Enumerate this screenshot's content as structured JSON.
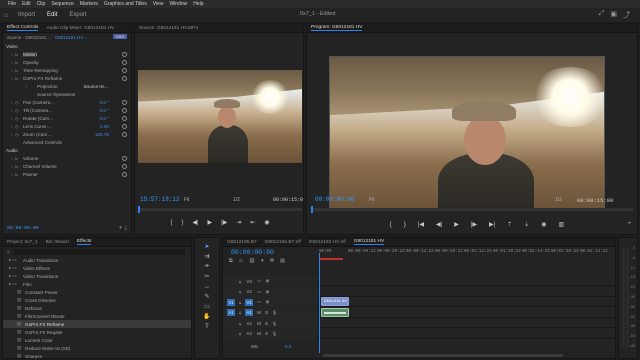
{
  "menubar": {
    "items": [
      "File",
      "Edit",
      "Clip",
      "Sequence",
      "Markers",
      "Graphics and Titles",
      "View",
      "Window",
      "Help"
    ]
  },
  "workspace": {
    "tabs": [
      "Import",
      "Edit",
      "Export"
    ],
    "active": "Edit",
    "title": "0x7_1 - Edited"
  },
  "effect_controls": {
    "tabs": [
      "Effect Controls",
      "Audio Clip Mixer: G8012181 HV",
      "Source: G8012181 HV.MP4"
    ],
    "source_label": "Source · G8012181…",
    "clip_label": "G8012181 HV…",
    "clip_chip": "G801",
    "video_header": "Video",
    "rows": [
      {
        "name": "Motion",
        "value": ""
      },
      {
        "name": "Opacity",
        "value": ""
      },
      {
        "name": "Time Remapping",
        "value": ""
      },
      {
        "name": "GoPro FX Reframe",
        "value": ""
      },
      {
        "name": "Projection",
        "value": "Source Im…"
      },
      {
        "name": "Source Operations",
        "value": ""
      },
      {
        "name": "Pan (Camera…",
        "value": "0.0 °"
      },
      {
        "name": "Tilt (Camera…",
        "value": "0.0 °"
      },
      {
        "name": "Rotate (Cam…",
        "value": "0.0 °"
      },
      {
        "name": "Lens Curve…",
        "value": "0.00"
      },
      {
        "name": "Zoom (Cam…",
        "value": "120.78"
      },
      {
        "name": "Advanced Controls",
        "value": ""
      }
    ],
    "audio_header": "Audio",
    "audio_rows": [
      {
        "name": "Volume",
        "value": ""
      },
      {
        "name": "Channel Volume",
        "value": ""
      },
      {
        "name": "Panner",
        "value": ""
      }
    ],
    "timecode": "00:00:00:00"
  },
  "source_monitor": {
    "tabs": [
      "Source: G8012181 HV.MP4"
    ],
    "timecode": "15:57:18:12",
    "fit": "Fit",
    "page": "1/2",
    "duration": "00:00:15:0"
  },
  "program_monitor": {
    "tab": "Program: G8012181 HV",
    "timecode": "00:00:00:00",
    "fit": "Fit",
    "page": "1/2",
    "duration": "00:00:15:00"
  },
  "project_panel": {
    "tabs": [
      "Project: 0x7_1",
      "Bin: Beach",
      "Effects"
    ],
    "active": "Effects",
    "items": [
      {
        "label": "Audio Transitions",
        "indent": 1
      },
      {
        "label": "Video Effects",
        "indent": 1
      },
      {
        "label": "Video Transitions",
        "indent": 1
      },
      {
        "label": "Film",
        "indent": 1
      },
      {
        "label": "Constant Power",
        "indent": 2
      },
      {
        "label": "Cross Dissolve",
        "indent": 2
      },
      {
        "label": "Defocus",
        "indent": 2
      },
      {
        "label": "FilmConvert Nitrate",
        "indent": 2
      },
      {
        "label": "GoPro FX Reframe",
        "indent": 2,
        "selected": true
      },
      {
        "label": "GoPro FX Reqalet",
        "indent": 2
      },
      {
        "label": "Lumetri Color",
        "indent": 2
      },
      {
        "label": "Reduce Noise v5 (SE)",
        "indent": 2
      },
      {
        "label": "Sharpen",
        "indent": 2
      }
    ]
  },
  "timeline": {
    "tabs": [
      "G8012185 B7",
      "G8012166 B7 eff",
      "G8012182 HV eff",
      "G8012181 HV"
    ],
    "active": "G8012181 HV",
    "timecode": "00:00:00:00",
    "ruler": [
      "00:00",
      "00:00:09:23",
      "00:00:29:23",
      "00:00:44:23",
      "00:00:59:23",
      "00:01:14:23",
      "00:01:29:23",
      "00:01:44:23",
      "00:01:59:23",
      "00:02:14:23"
    ],
    "tracks": [
      {
        "id": "V3",
        "label": "V3"
      },
      {
        "id": "V2",
        "label": "V2"
      },
      {
        "id": "V1",
        "label": "V1",
        "src": "V1"
      },
      {
        "id": "A1",
        "label": "A1",
        "src": "A1"
      },
      {
        "id": "A2",
        "label": "A2"
      },
      {
        "id": "A3",
        "label": "A3"
      }
    ],
    "mix_label": "Mix",
    "mix_value": "0.0",
    "clip_v_label": "G8012181 HV",
    "clip_a_label": ""
  },
  "audio_meter": {
    "labels": [
      "0",
      "-6",
      "-12",
      "-18",
      "-24",
      "-30",
      "-36",
      "-42",
      "-48",
      "-54",
      "dB"
    ]
  },
  "colors": {
    "accent": "#2f80ed",
    "timecode": "#2f9bff",
    "video_clip": "#7d8fc8",
    "audio_clip": "#5d8a6a"
  }
}
